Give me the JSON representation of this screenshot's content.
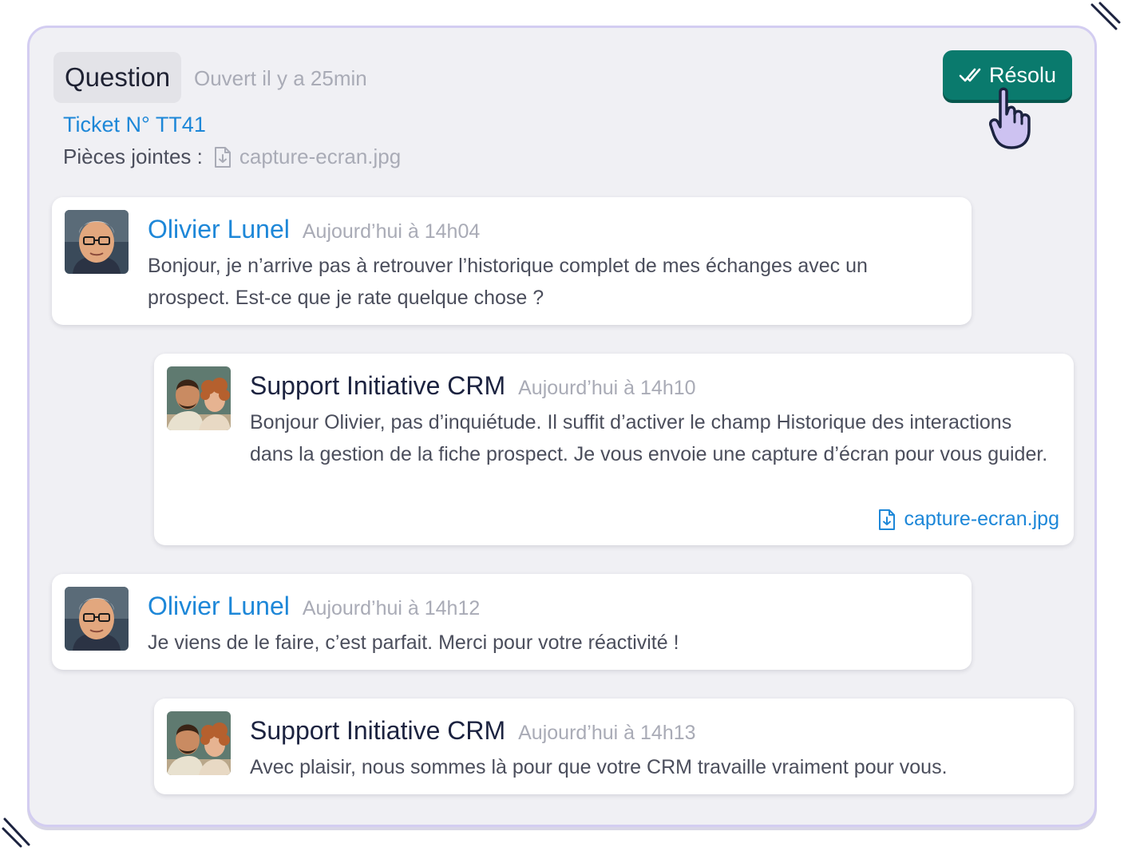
{
  "ticket": {
    "category": "Question",
    "opened": "Ouvert il y a 25min",
    "number": "Ticket N° TT41",
    "attachments_label": "Pièces jointes :",
    "attachment_file": "capture-ecran.jpg",
    "resolve_label": "Résolu"
  },
  "colors": {
    "accent_blue": "#1d87d8",
    "resolve_green": "#0a7a6d",
    "panel_border": "#d3cdf1"
  },
  "messages": [
    {
      "author": "Olivier Lunel",
      "role": "client",
      "time": "Aujourd’hui à 14h04",
      "text": "Bonjour, je n’arrive pas à retrouver l’historique complet de mes échanges avec un prospect. Est-ce que je rate quelque chose ?"
    },
    {
      "author": "Support Initiative CRM",
      "role": "support",
      "time": "Aujourd’hui à 14h10",
      "text": "Bonjour Olivier, pas d’inquiétude. Il suffit d’activer le champ Historique des interactions dans la gestion de la fiche prospect. Je vous envoie une capture d’écran pour vous guider.",
      "attachment": "capture-ecran.jpg"
    },
    {
      "author": "Olivier Lunel",
      "role": "client",
      "time": "Aujourd’hui à 14h12",
      "text": "Je viens de le faire, c’est parfait. Merci pour votre réactivité !"
    },
    {
      "author": "Support Initiative CRM",
      "role": "support",
      "time": "Aujourd’hui à 14h13",
      "text": "Avec plaisir, nous sommes là pour que votre CRM travaille vraiment pour vous."
    }
  ]
}
